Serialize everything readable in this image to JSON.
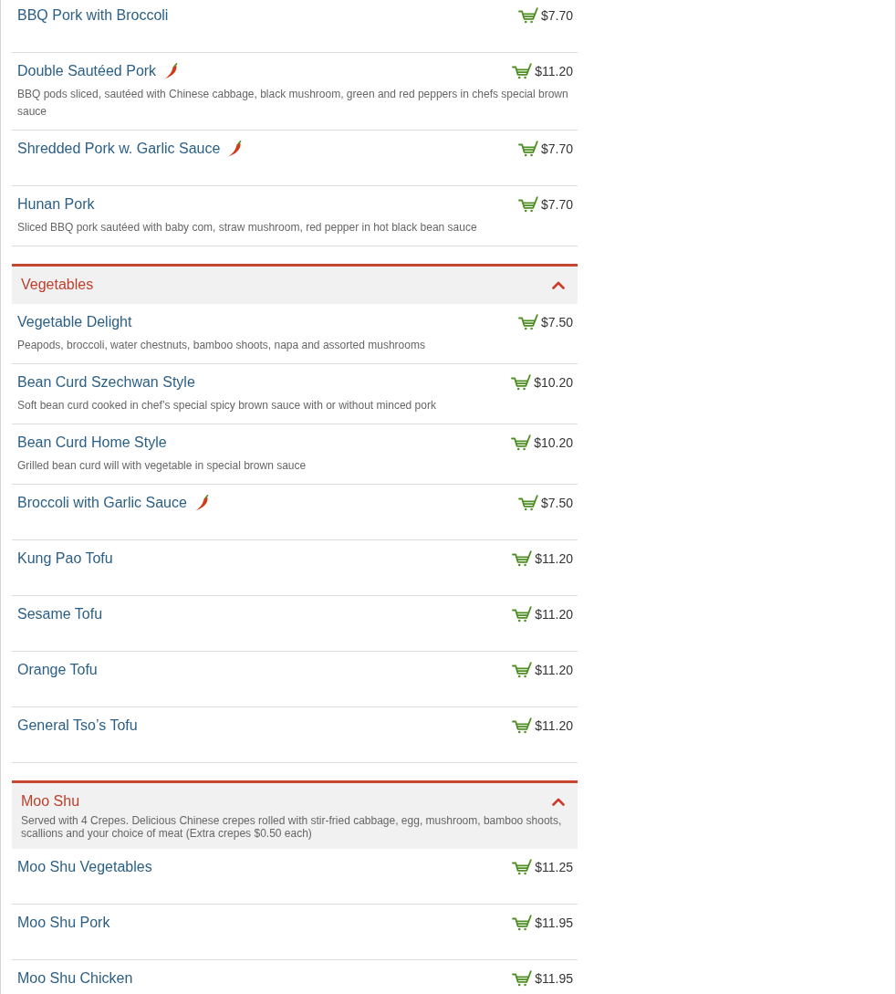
{
  "sections": [
    {
      "items": [
        {
          "name": "BBQ Pork with Broccoli",
          "spicy": false,
          "price": "$7.70"
        },
        {
          "name": "Double Sautéed Pork",
          "spicy": true,
          "price": "$11.20",
          "description": "BBQ pods sliced, sautéed with Chinese cabbage, black mushroom, green and red peppers in chefs special brown sauce"
        },
        {
          "name": "Shredded Pork w. Garlic Sauce",
          "spicy": true,
          "price": "$7.70"
        },
        {
          "name": "Hunan Pork",
          "spicy": false,
          "price": "$7.70",
          "description": "Sliced BBQ pork sautéed with baby com, straw mushroom, red pepper in hot black bean sauce"
        }
      ]
    },
    {
      "title": "Vegetables",
      "expanded": true,
      "items": [
        {
          "name": "Vegetable Delight",
          "spicy": false,
          "price": "$7.50",
          "description": "Peapods, broccoli, water chestnuts, bamboo shoots, napa and assorted mushrooms"
        },
        {
          "name": "Bean Curd Szechwan Style",
          "spicy": false,
          "price": "$10.20",
          "description": "Soft bean curd cooked in chef’s special spicy brown sauce with or without minced pork"
        },
        {
          "name": "Bean Curd Home Style",
          "spicy": false,
          "price": "$10.20",
          "description": "Grilled bean curd will with vegetable in special brown sauce"
        },
        {
          "name": "Broccoli with Garlic Sauce",
          "spicy": true,
          "price": "$7.50"
        },
        {
          "name": "Kung Pao Tofu",
          "spicy": false,
          "price": "$11.20"
        },
        {
          "name": "Sesame Tofu",
          "spicy": false,
          "price": "$11.20"
        },
        {
          "name": "Orange Tofu",
          "spicy": false,
          "price": "$11.20"
        },
        {
          "name": "General Tso’s Tofu",
          "spicy": false,
          "price": "$11.20"
        }
      ]
    },
    {
      "title": "Moo Shu",
      "expanded": true,
      "description": "Served with 4 Crepes. Delicious Chinese crepes rolled with stir-fried cabbage, egg, mushroom, bamboo shoots, scallions and your choice of meat (Extra crepes $0.50 each)",
      "items": [
        {
          "name": "Moo Shu Vegetables",
          "spicy": false,
          "price": "$11.25"
        },
        {
          "name": "Moo Shu Pork",
          "spicy": false,
          "price": "$11.95"
        },
        {
          "name": "Moo Shu Chicken",
          "spicy": false,
          "price": "$11.95"
        }
      ]
    }
  ]
}
